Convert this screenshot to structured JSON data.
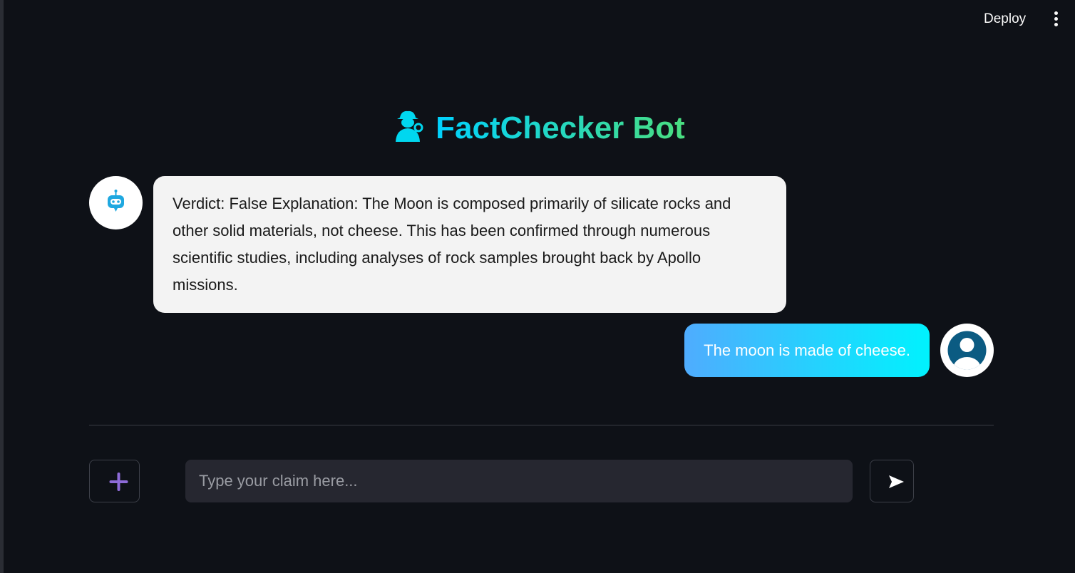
{
  "toolbar": {
    "deploy_label": "Deploy",
    "menu_icon": "kebab-menu-icon"
  },
  "header": {
    "title": "FactChecker Bot",
    "icon": "detective-icon"
  },
  "chat": {
    "messages": [
      {
        "role": "assistant",
        "avatar_icon": "robot-icon",
        "text": "Verdict: False Explanation: The Moon is composed primarily of silicate rocks and other solid materials, not cheese. This has been confirmed through numerous scientific studies, including analyses of rock samples brought back by Apollo missions."
      },
      {
        "role": "user",
        "avatar_icon": "user-icon",
        "text": "The moon is made of cheese."
      }
    ]
  },
  "input": {
    "placeholder": "Type your claim here...",
    "value": "",
    "add_icon": "plus-icon",
    "send_icon": "send-arrow-icon"
  },
  "colors": {
    "background": "#0e1117",
    "title_gradient_start": "#00d2ff",
    "title_gradient_end": "#4ade80",
    "bot_bubble": "#f3f3f3",
    "user_bubble_start": "#4facfe",
    "user_bubble_end": "#00f2fe",
    "input_bg": "#262730",
    "plus_icon": "#8e6bd9"
  }
}
